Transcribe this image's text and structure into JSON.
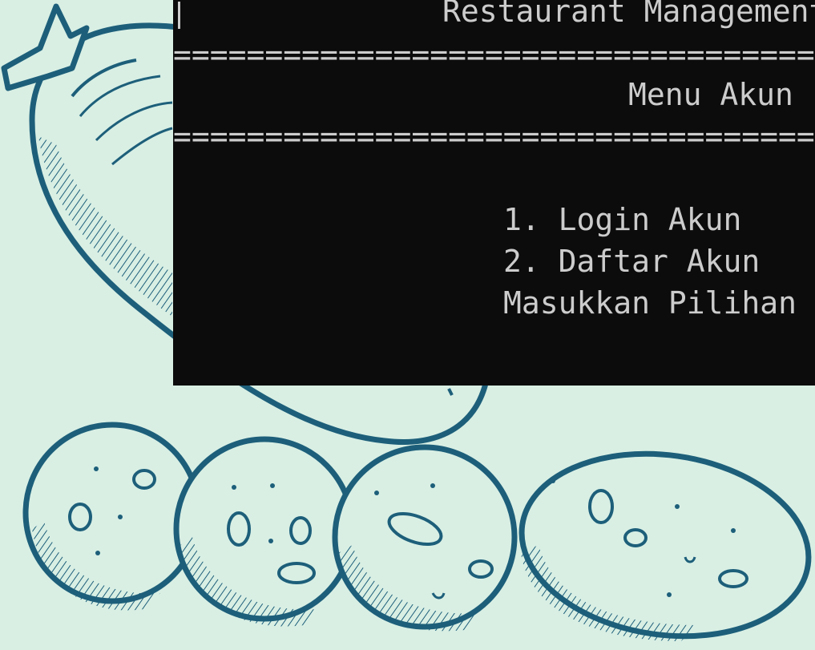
{
  "wallpaper": {
    "background_color": "#d9efe4",
    "ink_color": "#1d5f7a",
    "subject": "sketched sausage and sliced sausage pieces"
  },
  "terminal": {
    "background_color": "#0c0c0c",
    "text_color": "#cccccc",
    "lines": {
      "title": "Restaurant Management System",
      "separator_top": "=====================================================",
      "menu_title": "Menu Akun",
      "separator_bottom": "=====================================================",
      "option_1": "1. Login Akun",
      "option_2": "2. Daftar Akun",
      "prompt": "Masukkan Pilihan : "
    }
  }
}
